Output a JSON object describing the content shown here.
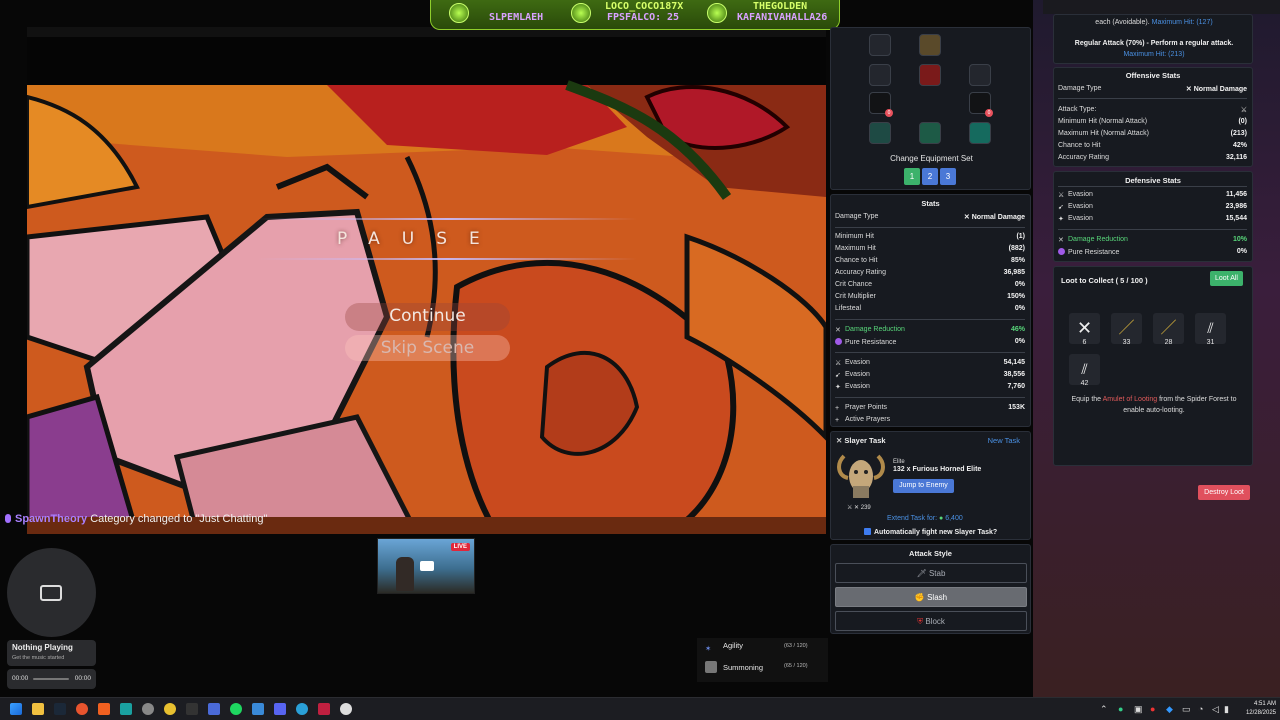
{
  "banner": {
    "left_name": "SLPEMLAEH",
    "center_name": "LOCO_COCO187X",
    "center_sub": "FPSFALCO:",
    "center_count": "25",
    "right_name": "THEGOLDEN",
    "right_sub": "KAFANIVAHALLA26"
  },
  "pause": {
    "title": "PAUSE",
    "continue": "Continue",
    "skip": "Skip Scene"
  },
  "chat": {
    "user": "SpawnTheory",
    "message": "Category changed to \"Just Chatting\""
  },
  "thumbnail": {
    "live": "LIVE"
  },
  "equipment": {
    "caption": "Change Equipment Set",
    "sets": [
      "1",
      "2",
      "3"
    ],
    "slot_badges": [
      "0",
      "0"
    ]
  },
  "stats": {
    "title": "Stats",
    "damage_type_label": "Damage Type",
    "damage_type_value": "Normal Damage",
    "rows": [
      {
        "label": "Minimum Hit",
        "value": "(1)"
      },
      {
        "label": "Maximum Hit",
        "value": "(882)"
      },
      {
        "label": "Chance to Hit",
        "value": "85%"
      },
      {
        "label": "Accuracy Rating",
        "value": "36,985"
      },
      {
        "label": "Crit Chance",
        "value": "0%"
      },
      {
        "label": "Crit Multiplier",
        "value": "150%"
      },
      {
        "label": "Lifesteal",
        "value": "0%"
      }
    ],
    "damage_reduction": {
      "label": "Damage Reduction",
      "value": "46%"
    },
    "pure_resistance": {
      "label": "Pure Resistance",
      "value": "0%"
    },
    "evasion": [
      {
        "label": "Evasion",
        "value": "54,145"
      },
      {
        "label": "Evasion",
        "value": "38,556"
      },
      {
        "label": "Evasion",
        "value": "7,760"
      }
    ],
    "prayer_points": {
      "label": "Prayer Points",
      "value": "153K"
    },
    "active_prayers": "Active Prayers"
  },
  "slayer": {
    "title": "Slayer Task",
    "new_task": "New Task",
    "tier": "Elite",
    "task": "132 x Furious Horned Elite",
    "jump": "Jump to Enemy",
    "level": "239",
    "extend_label": "Extend Task for:",
    "extend_cost": "6,400",
    "auto_fight": "Automatically fight new Slayer Task?"
  },
  "attack_style": {
    "title": "Attack Style",
    "stab": "Stab",
    "slash": "Slash",
    "block": "Block",
    "selected": "Slash"
  },
  "skills": [
    {
      "name": "Agility",
      "level": "(63 / 120)"
    },
    {
      "name": "Summoning",
      "level": "(65 / 120)"
    }
  ],
  "enemy": {
    "avoid_text": "each (Avoidable).",
    "avoid_max": "Maximum Hit: (127)",
    "regular_attack": "Regular Attack (70%) - Perform a regular attack.",
    "regular_max": "Maximum Hit: (213)",
    "offensive_title": "Offensive Stats",
    "damage_type_label": "Damage Type",
    "damage_type_value": "Normal Damage",
    "attack_type_label": "Attack Type:",
    "offensive_rows": [
      {
        "label": "Minimum Hit (Normal Attack)",
        "value": "(0)"
      },
      {
        "label": "Maximum Hit (Normal Attack)",
        "value": "(213)"
      },
      {
        "label": "Chance to Hit",
        "value": "42%"
      },
      {
        "label": "Accuracy Rating",
        "value": "32,116"
      }
    ],
    "defensive_title": "Defensive Stats",
    "evasion": [
      {
        "label": "Evasion",
        "value": "11,456"
      },
      {
        "label": "Evasion",
        "value": "23,986"
      },
      {
        "label": "Evasion",
        "value": "15,544"
      }
    ],
    "damage_reduction": {
      "label": "Damage Reduction",
      "value": "10%"
    },
    "pure_resistance": {
      "label": "Pure Resistance",
      "value": "0%"
    }
  },
  "loot": {
    "title": "Loot to Collect ( 5 / 100 )",
    "loot_all": "Loot All",
    "counts": [
      "6",
      "33",
      "28",
      "31",
      "42"
    ],
    "hint_prefix": "Equip the ",
    "hint_link": "Amulet of Looting",
    "hint_suffix": " from the Spider Forest to enable auto-looting.",
    "destroy": "Destroy Loot"
  },
  "music": {
    "title": "Nothing Playing",
    "subtitle": "Get the music started",
    "time_start": "00:00",
    "time_end": "00:00"
  },
  "taskbar": {
    "time": "4:51 AM",
    "date": "12/28/2025"
  },
  "colors": {
    "accent_green": "#58d67a",
    "link_blue": "#4a90e2",
    "danger": "#e0505d",
    "loot_green": "#3cb26b"
  }
}
